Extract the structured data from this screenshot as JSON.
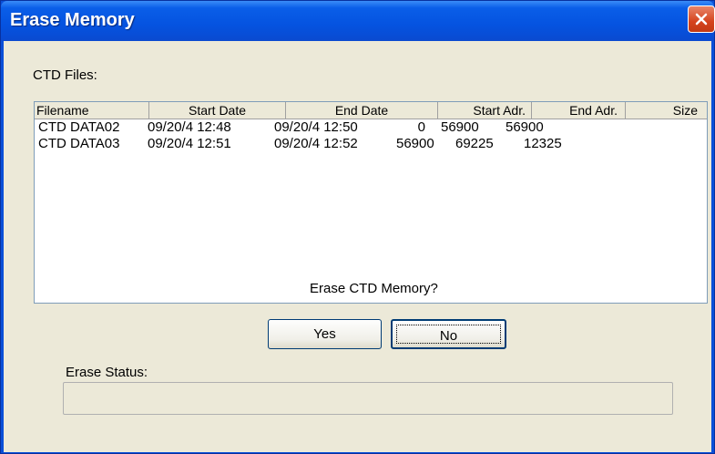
{
  "window": {
    "title": "Erase Memory"
  },
  "labels": {
    "ctd_files": "CTD Files:",
    "question": "Erase CTD Memory?",
    "erase_status": "Erase Status:"
  },
  "table": {
    "columns": [
      "Filename",
      "Start Date",
      "End Date",
      "Start Adr.",
      "End Adr.",
      "Size"
    ],
    "rows": [
      [
        "CTD DATA02",
        "09/20/4 12:48",
        "09/20/4 12:50",
        "0",
        "56900",
        "56900"
      ],
      [
        "CTD DATA03",
        "09/20/4 12:51",
        "09/20/4 12:52",
        "56900",
        "69225",
        "12325"
      ]
    ]
  },
  "buttons": {
    "yes": "Yes",
    "no": "No"
  },
  "status": {
    "progress": 0
  },
  "icons": {
    "close": "close-icon"
  },
  "colors": {
    "titlebar": "#0a5ee8",
    "close": "#d5431d",
    "dialog_bg": "#ece9d8"
  }
}
